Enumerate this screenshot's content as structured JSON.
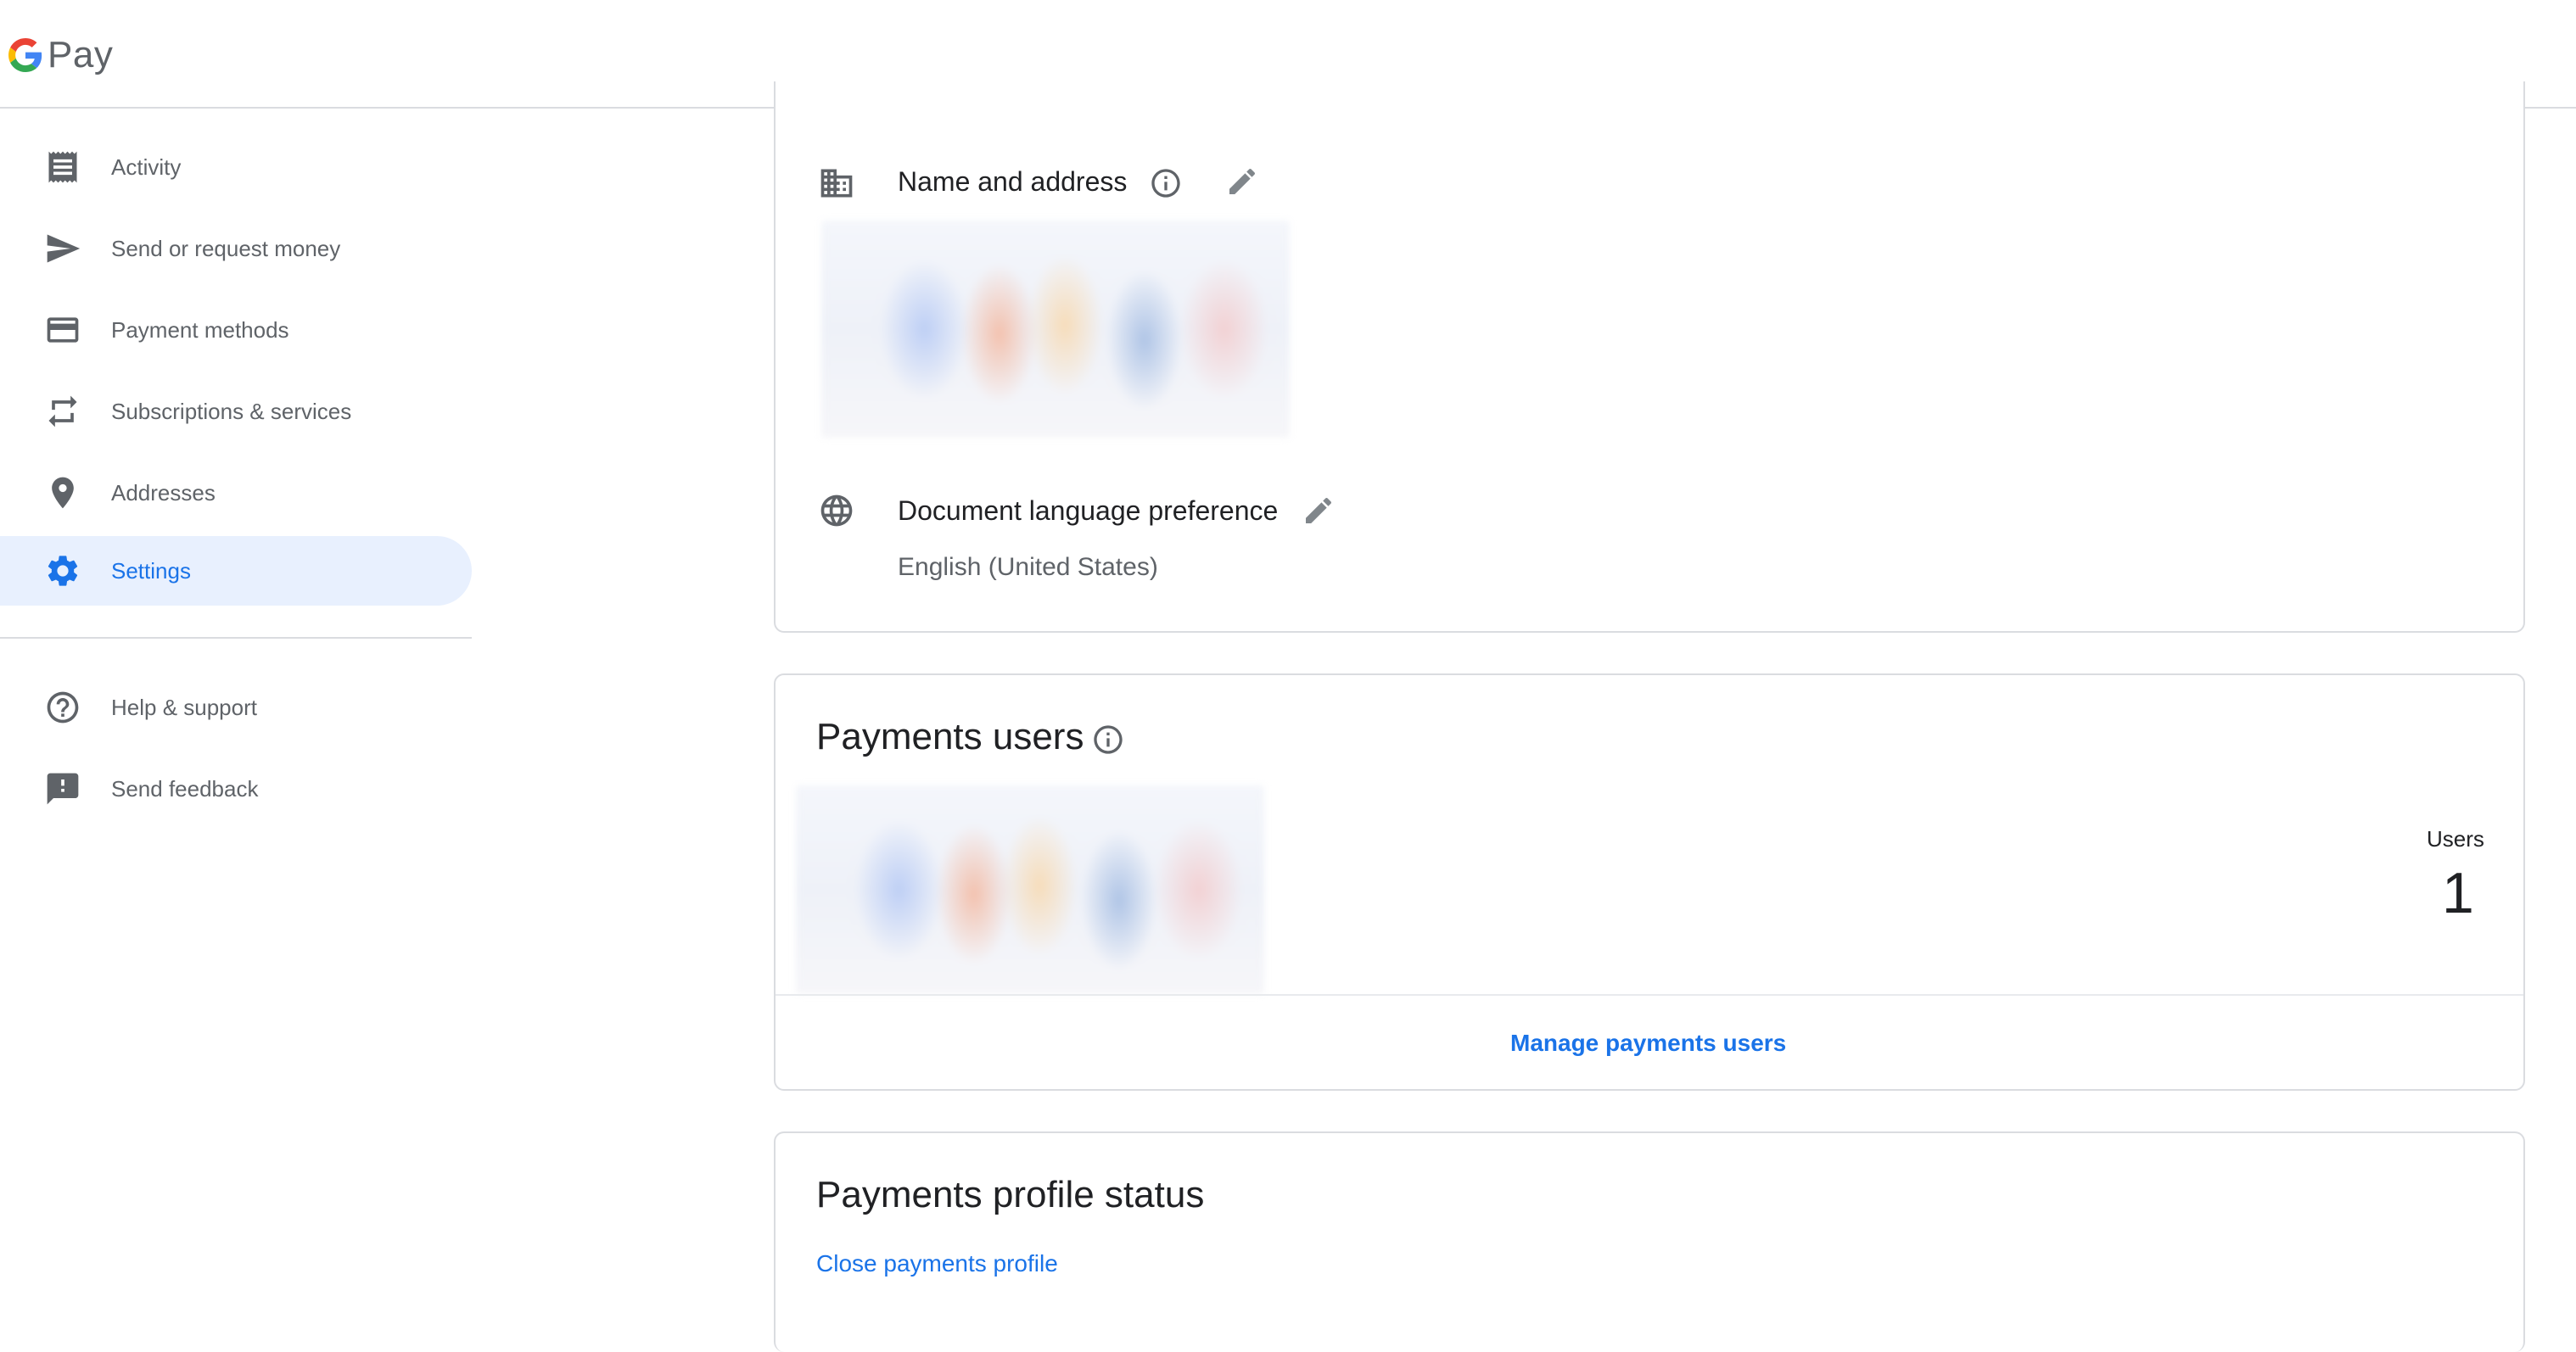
{
  "header": {
    "logo_text": "Pay"
  },
  "sidebar": {
    "items": [
      {
        "label": "Activity",
        "icon": "receipt-icon"
      },
      {
        "label": "Send or request money",
        "icon": "send-icon"
      },
      {
        "label": "Payment methods",
        "icon": "credit-card-icon"
      },
      {
        "label": "Subscriptions & services",
        "icon": "repeat-icon"
      },
      {
        "label": "Addresses",
        "icon": "location-pin-icon"
      },
      {
        "label": "Settings",
        "icon": "gear-icon",
        "active": true
      }
    ],
    "secondary_items": [
      {
        "label": "Help & support",
        "icon": "help-icon"
      },
      {
        "label": "Send feedback",
        "icon": "feedback-icon"
      }
    ]
  },
  "profile_card": {
    "name_address": {
      "title": "Name and address",
      "icon": "building-icon"
    },
    "document_language": {
      "title": "Document language preference",
      "value": "English (United States)",
      "icon": "globe-icon"
    }
  },
  "payments_users": {
    "title": "Payments users",
    "users_label": "Users",
    "users_count": "1",
    "manage_link": "Manage payments users"
  },
  "profile_status": {
    "title": "Payments profile status",
    "close_link": "Close payments profile"
  },
  "colors": {
    "accent": "#1a73e8",
    "active_nav_bg": "#e8f0fe",
    "icon_gray": "#5f6368",
    "border": "#dadce0"
  }
}
